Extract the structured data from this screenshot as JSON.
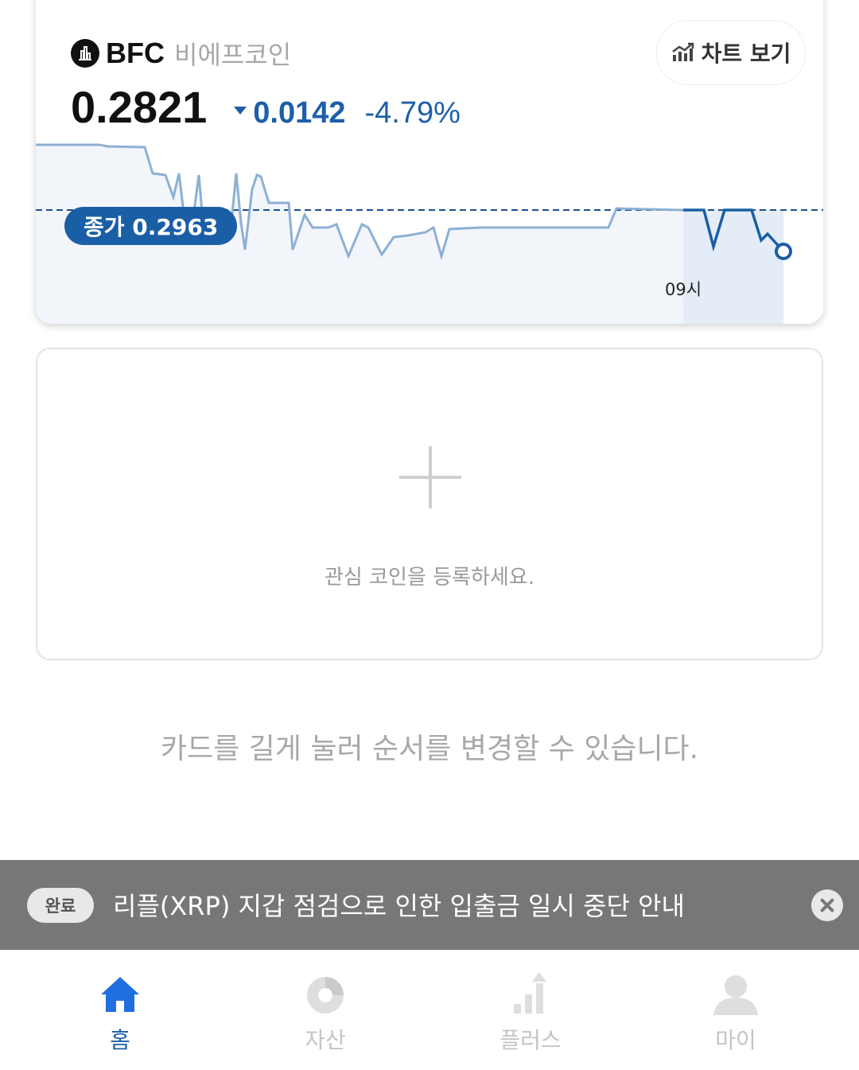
{
  "coin": {
    "symbol": "BFC",
    "name": "비에프코인",
    "price": "0.2821",
    "change": "0.0142",
    "change_pct": "-4.79%",
    "chart_button": "차트 보기",
    "close_label": "종가 0.2963",
    "hour_label": "09시"
  },
  "chart_data": {
    "type": "line",
    "reference_line": 0.2963,
    "last_value": 0.2821
  },
  "add_card": {
    "text": "관심 코인을 등록하세요."
  },
  "hint": "카드를 길게 눌러 순서를 변경할 수 있습니다.",
  "notice": {
    "badge": "완료",
    "text": "리플(XRP) 지갑 점검으로 인한 입출금 일시 중단 안내"
  },
  "tabs": [
    {
      "label": "홈",
      "icon": "home-icon"
    },
    {
      "label": "자산",
      "icon": "pie-chart-icon"
    },
    {
      "label": "플러스",
      "icon": "growth-chart-icon"
    },
    {
      "label": "마이",
      "icon": "user-icon"
    }
  ],
  "colors": {
    "accent": "#1a5ea6",
    "down": "#1d5fa8",
    "notice_bg": "#777777"
  }
}
